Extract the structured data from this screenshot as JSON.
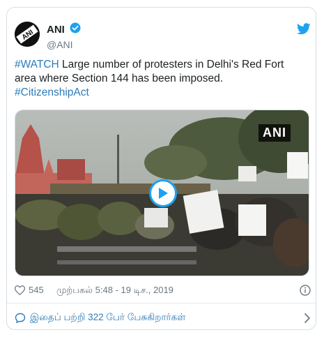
{
  "account": {
    "name": "ANI",
    "handle": "@ANI",
    "avatar_text": "ANI"
  },
  "tweet": {
    "hashtag_watch": "#WATCH",
    "body": " Large number of protesters in Delhi's Red Fort area where Section 144 has been imposed.",
    "hashtag_citizenship": "#CitizenshipAct"
  },
  "media": {
    "watermark": "ANI",
    "play_icon": "play-icon"
  },
  "meta": {
    "likes": "545",
    "timestamp": "முற்பகல் 5:48 - 19 டிச., 2019"
  },
  "footer": {
    "conversation": "இதைப் பற்றி 322 பேர் பேசுகிறார்கள்"
  },
  "colors": {
    "accent": "#1da1f2",
    "link": "#2b7bb9",
    "muted": "#697882"
  }
}
